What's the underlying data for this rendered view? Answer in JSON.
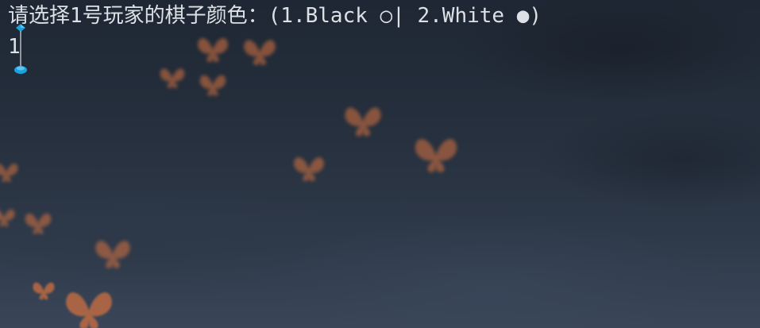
{
  "terminal": {
    "prompt": "请选择1号玩家的棋子颜色：(1.Black ○| 2.White ●)",
    "input_value": "1"
  },
  "colors": {
    "text": "#dde1e6",
    "selection_handle": "#1aa3e0",
    "butterfly": "#d9733f"
  },
  "icons": {
    "selection_handle": "text-selection-handle-icon",
    "butterflies": "butterfly-icon"
  }
}
